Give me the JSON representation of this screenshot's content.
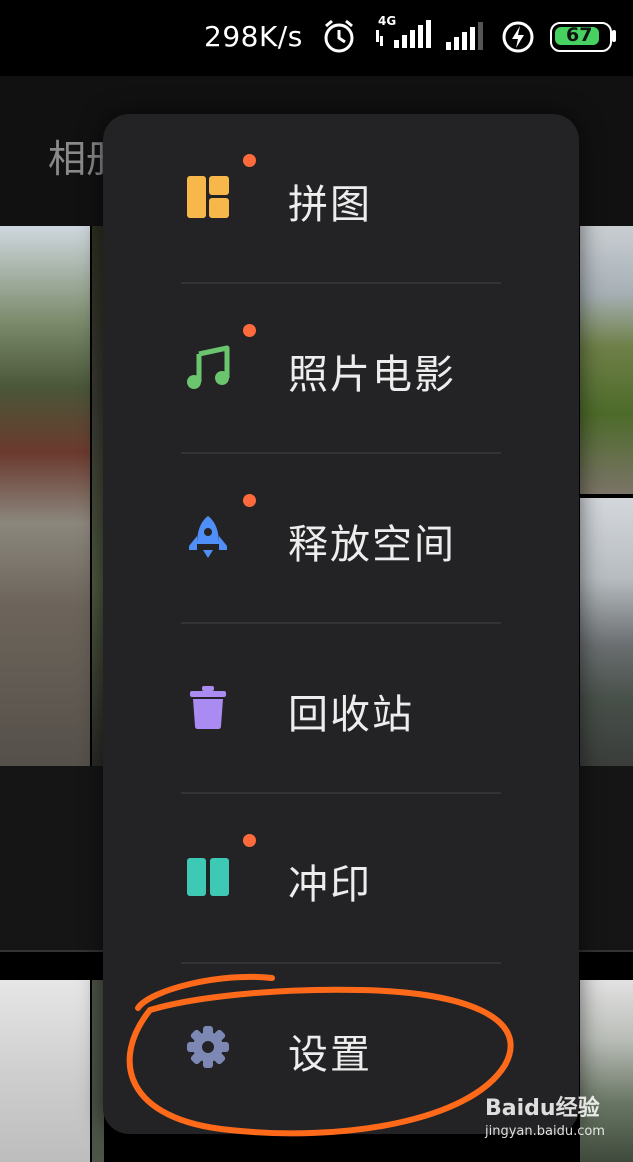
{
  "status_bar": {
    "speed": "298K/s",
    "network": "4G",
    "battery": "67",
    "icons": [
      "alarm-icon",
      "signal-4g-icon",
      "signal-icon",
      "charging-icon",
      "battery-icon"
    ]
  },
  "background_app": {
    "title": "相册"
  },
  "menu": {
    "items": [
      {
        "label": "拼图",
        "icon": "collage-icon",
        "color": "#f8b74a",
        "new_dot": true
      },
      {
        "label": "照片电影",
        "icon": "music-note-icon",
        "color": "#6bc56e",
        "new_dot": true
      },
      {
        "label": "释放空间",
        "icon": "rocket-icon",
        "color": "#4f8ff7",
        "new_dot": true
      },
      {
        "label": "回收站",
        "icon": "trash-icon",
        "color": "#a98bf2",
        "new_dot": false
      },
      {
        "label": "冲印",
        "icon": "print-icon",
        "color": "#3ec9b5",
        "new_dot": true
      },
      {
        "label": "设置",
        "icon": "gear-icon",
        "color": "#7d88b5",
        "new_dot": false
      }
    ]
  },
  "colors": {
    "menu_bg": "#232325",
    "notification_dot": "#ff6a3c",
    "annotation_circle": "#ff6a1a"
  },
  "watermark": {
    "brand": "Baidu经验",
    "url": "jingyan.baidu.com"
  }
}
